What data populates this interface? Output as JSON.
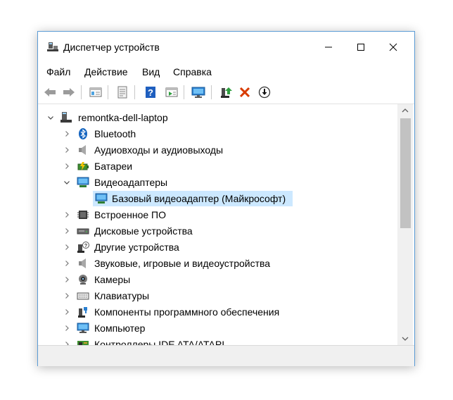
{
  "window": {
    "title": "Диспетчер устройств"
  },
  "menu": [
    "Файл",
    "Действие",
    "Вид",
    "Справка"
  ],
  "toolbar": {
    "buttons": [
      "back-icon",
      "forward-icon",
      "properties-view-icon",
      "resources-icon",
      "help-icon",
      "action-view-icon",
      "scan-hardware-icon",
      "update-driver-icon",
      "uninstall-icon",
      "disable-device-icon"
    ]
  },
  "tree": {
    "root": "remontka-dell-laptop",
    "items": [
      {
        "label": "Bluetooth",
        "icon": "bluetooth-icon",
        "expanded": false
      },
      {
        "label": "Аудиовходы и аудиовыходы",
        "icon": "speaker-icon",
        "expanded": false
      },
      {
        "label": "Батареи",
        "icon": "battery-icon",
        "expanded": false
      },
      {
        "label": "Видеоадаптеры",
        "icon": "display-adapter-icon",
        "expanded": true
      },
      {
        "label": "Базовый видеоадаптер (Майкрософт)",
        "icon": "display-adapter-icon",
        "child": true,
        "selected": true
      },
      {
        "label": "Встроенное ПО",
        "icon": "firmware-icon",
        "expanded": false
      },
      {
        "label": "Дисковые устройства",
        "icon": "disk-icon",
        "expanded": false
      },
      {
        "label": "Другие устройства",
        "icon": "unknown-device-icon",
        "expanded": false
      },
      {
        "label": "Звуковые, игровые и видеоустройства",
        "icon": "sound-icon",
        "expanded": false
      },
      {
        "label": "Камеры",
        "icon": "camera-icon",
        "expanded": false
      },
      {
        "label": "Клавиатуры",
        "icon": "keyboard-icon",
        "expanded": false
      },
      {
        "label": "Компоненты программного обеспечения",
        "icon": "software-component-icon",
        "expanded": false
      },
      {
        "label": "Компьютер",
        "icon": "computer-icon",
        "expanded": false
      },
      {
        "label": "Контроллеры IDE ATA/ATAPI",
        "icon": "ide-controller-icon",
        "expanded": false
      }
    ]
  },
  "colors": {
    "selection": "#cce8ff",
    "accent": "#0078d7",
    "window_border": "#5b9bd5"
  }
}
